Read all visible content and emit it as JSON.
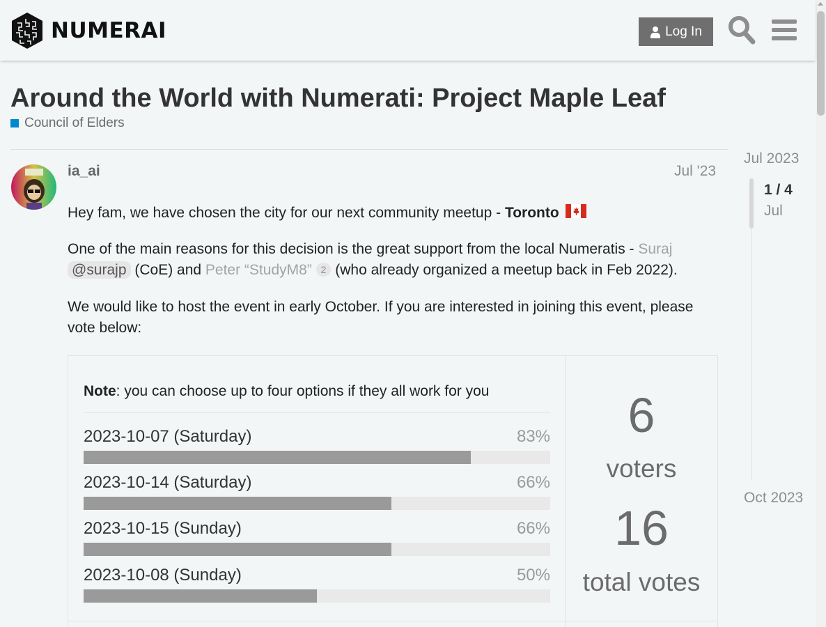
{
  "header": {
    "logo_text": "NUMERAI",
    "login_label": "Log In",
    "search_icon": "search-icon",
    "menu_icon": "hamburger-menu-icon"
  },
  "topic": {
    "title": "Around the World with Numerati: Project Maple Leaf",
    "category": "Council of Elders",
    "category_color": "#0088cc"
  },
  "post": {
    "username": "ia_ai",
    "date": "Jul '23",
    "p1_text": "Hey fam, we have chosen the city for our next community meetup - ",
    "p1_bold": "Toronto",
    "p1_flag": "canada-flag-icon",
    "p2_a": "One of the main reasons for this decision is the great support from the local Numeratis - ",
    "p2_link1": "Suraj",
    "p2_mention": "@surajp",
    "p2_b": " (CoE) and ",
    "p2_link2": "Peter “StudyM8”",
    "p2_badge": "2",
    "p2_c": " (who already organized a meetup back in Feb 2022).",
    "p3_text": "We would like to host the event in early October. If you are interested in joining this event, please vote below:"
  },
  "poll": {
    "note_bold": "Note",
    "note_text": ": you can choose up to four options if they all work for you",
    "options": [
      {
        "label": "2023-10-07 (Saturday)",
        "percent_label": "83%",
        "percent": 83
      },
      {
        "label": "2023-10-14 (Saturday)",
        "percent_label": "66%",
        "percent": 66
      },
      {
        "label": "2023-10-15 (Sunday)",
        "percent_label": "66%",
        "percent": 66
      },
      {
        "label": "2023-10-08 (Sunday)",
        "percent_label": "50%",
        "percent": 50
      }
    ],
    "voters_count": "6",
    "voters_label": "voters",
    "votes_count": "16",
    "votes_label": "total votes"
  },
  "timeline": {
    "start": "Jul 2023",
    "position": "1 / 4",
    "current_month": "Jul",
    "end": "Oct 2023"
  }
}
